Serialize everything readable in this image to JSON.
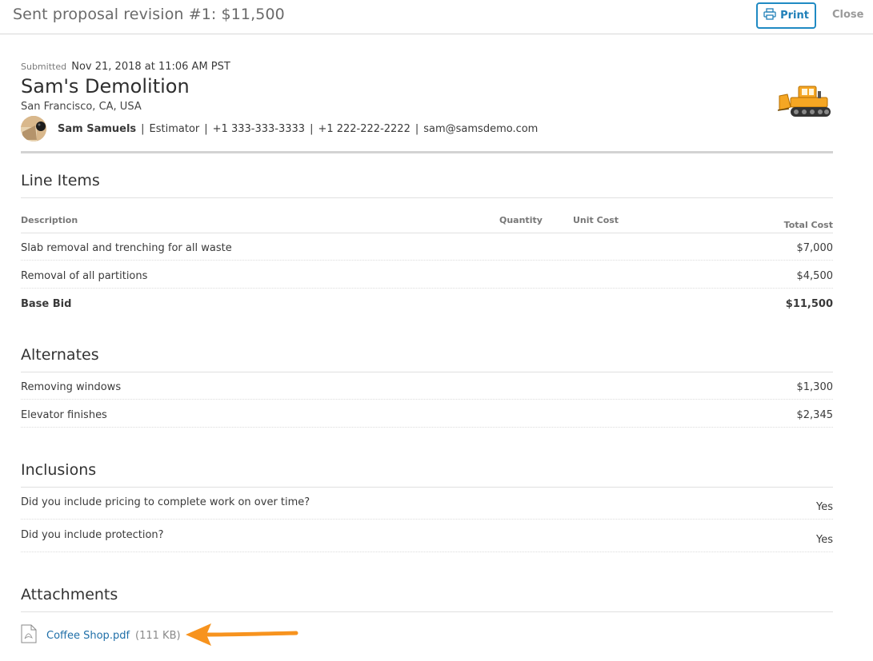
{
  "header": {
    "title": "Sent proposal revision #1: $11,500",
    "print_label": "Print",
    "close_label": "Close"
  },
  "submission": {
    "submitted_label": "Submitted",
    "submitted_at": "Nov 21, 2018 at 11:06 AM PST",
    "company": "Sam's Demolition",
    "location": "San Francisco, CA, USA",
    "contact_name": "Sam Samuels",
    "contact_role": "Estimator",
    "phone_1": "+1 333-333-3333",
    "phone_2": "+1 222-222-2222",
    "email": "sam@samsdemo.com",
    "separator": "|"
  },
  "line_items": {
    "title": "Line Items",
    "columns": {
      "description": "Description",
      "quantity": "Quantity",
      "unit_cost": "Unit Cost",
      "total_cost": "Total Cost"
    },
    "rows": [
      {
        "description": "Slab removal and trenching for all waste",
        "total": "$7,000"
      },
      {
        "description": "Removal of all partitions",
        "total": "$4,500"
      }
    ],
    "base_bid": {
      "label": "Base Bid",
      "total": "$11,500"
    }
  },
  "alternates": {
    "title": "Alternates",
    "rows": [
      {
        "description": "Removing windows",
        "total": "$1,300"
      },
      {
        "description": "Elevator finishes",
        "total": "$2,345"
      }
    ]
  },
  "inclusions": {
    "title": "Inclusions",
    "rows": [
      {
        "question": "Did you include pricing to complete work on over time?",
        "answer": "Yes"
      },
      {
        "question": "Did you include protection?",
        "answer": "Yes"
      }
    ]
  },
  "attachments": {
    "title": "Attachments",
    "files": [
      {
        "name": "Coffee Shop.pdf",
        "size": "(111 KB)"
      }
    ]
  },
  "icons": {
    "print": "printer-icon",
    "logo": "bulldozer-logo-icon",
    "file": "pdf-file-icon",
    "annotation": "arrow-icon"
  },
  "colors": {
    "accent": "#1f8ac3",
    "link": "#1f6fa8",
    "annotation_arrow": "#f7931e",
    "logo": "#f5a623"
  }
}
